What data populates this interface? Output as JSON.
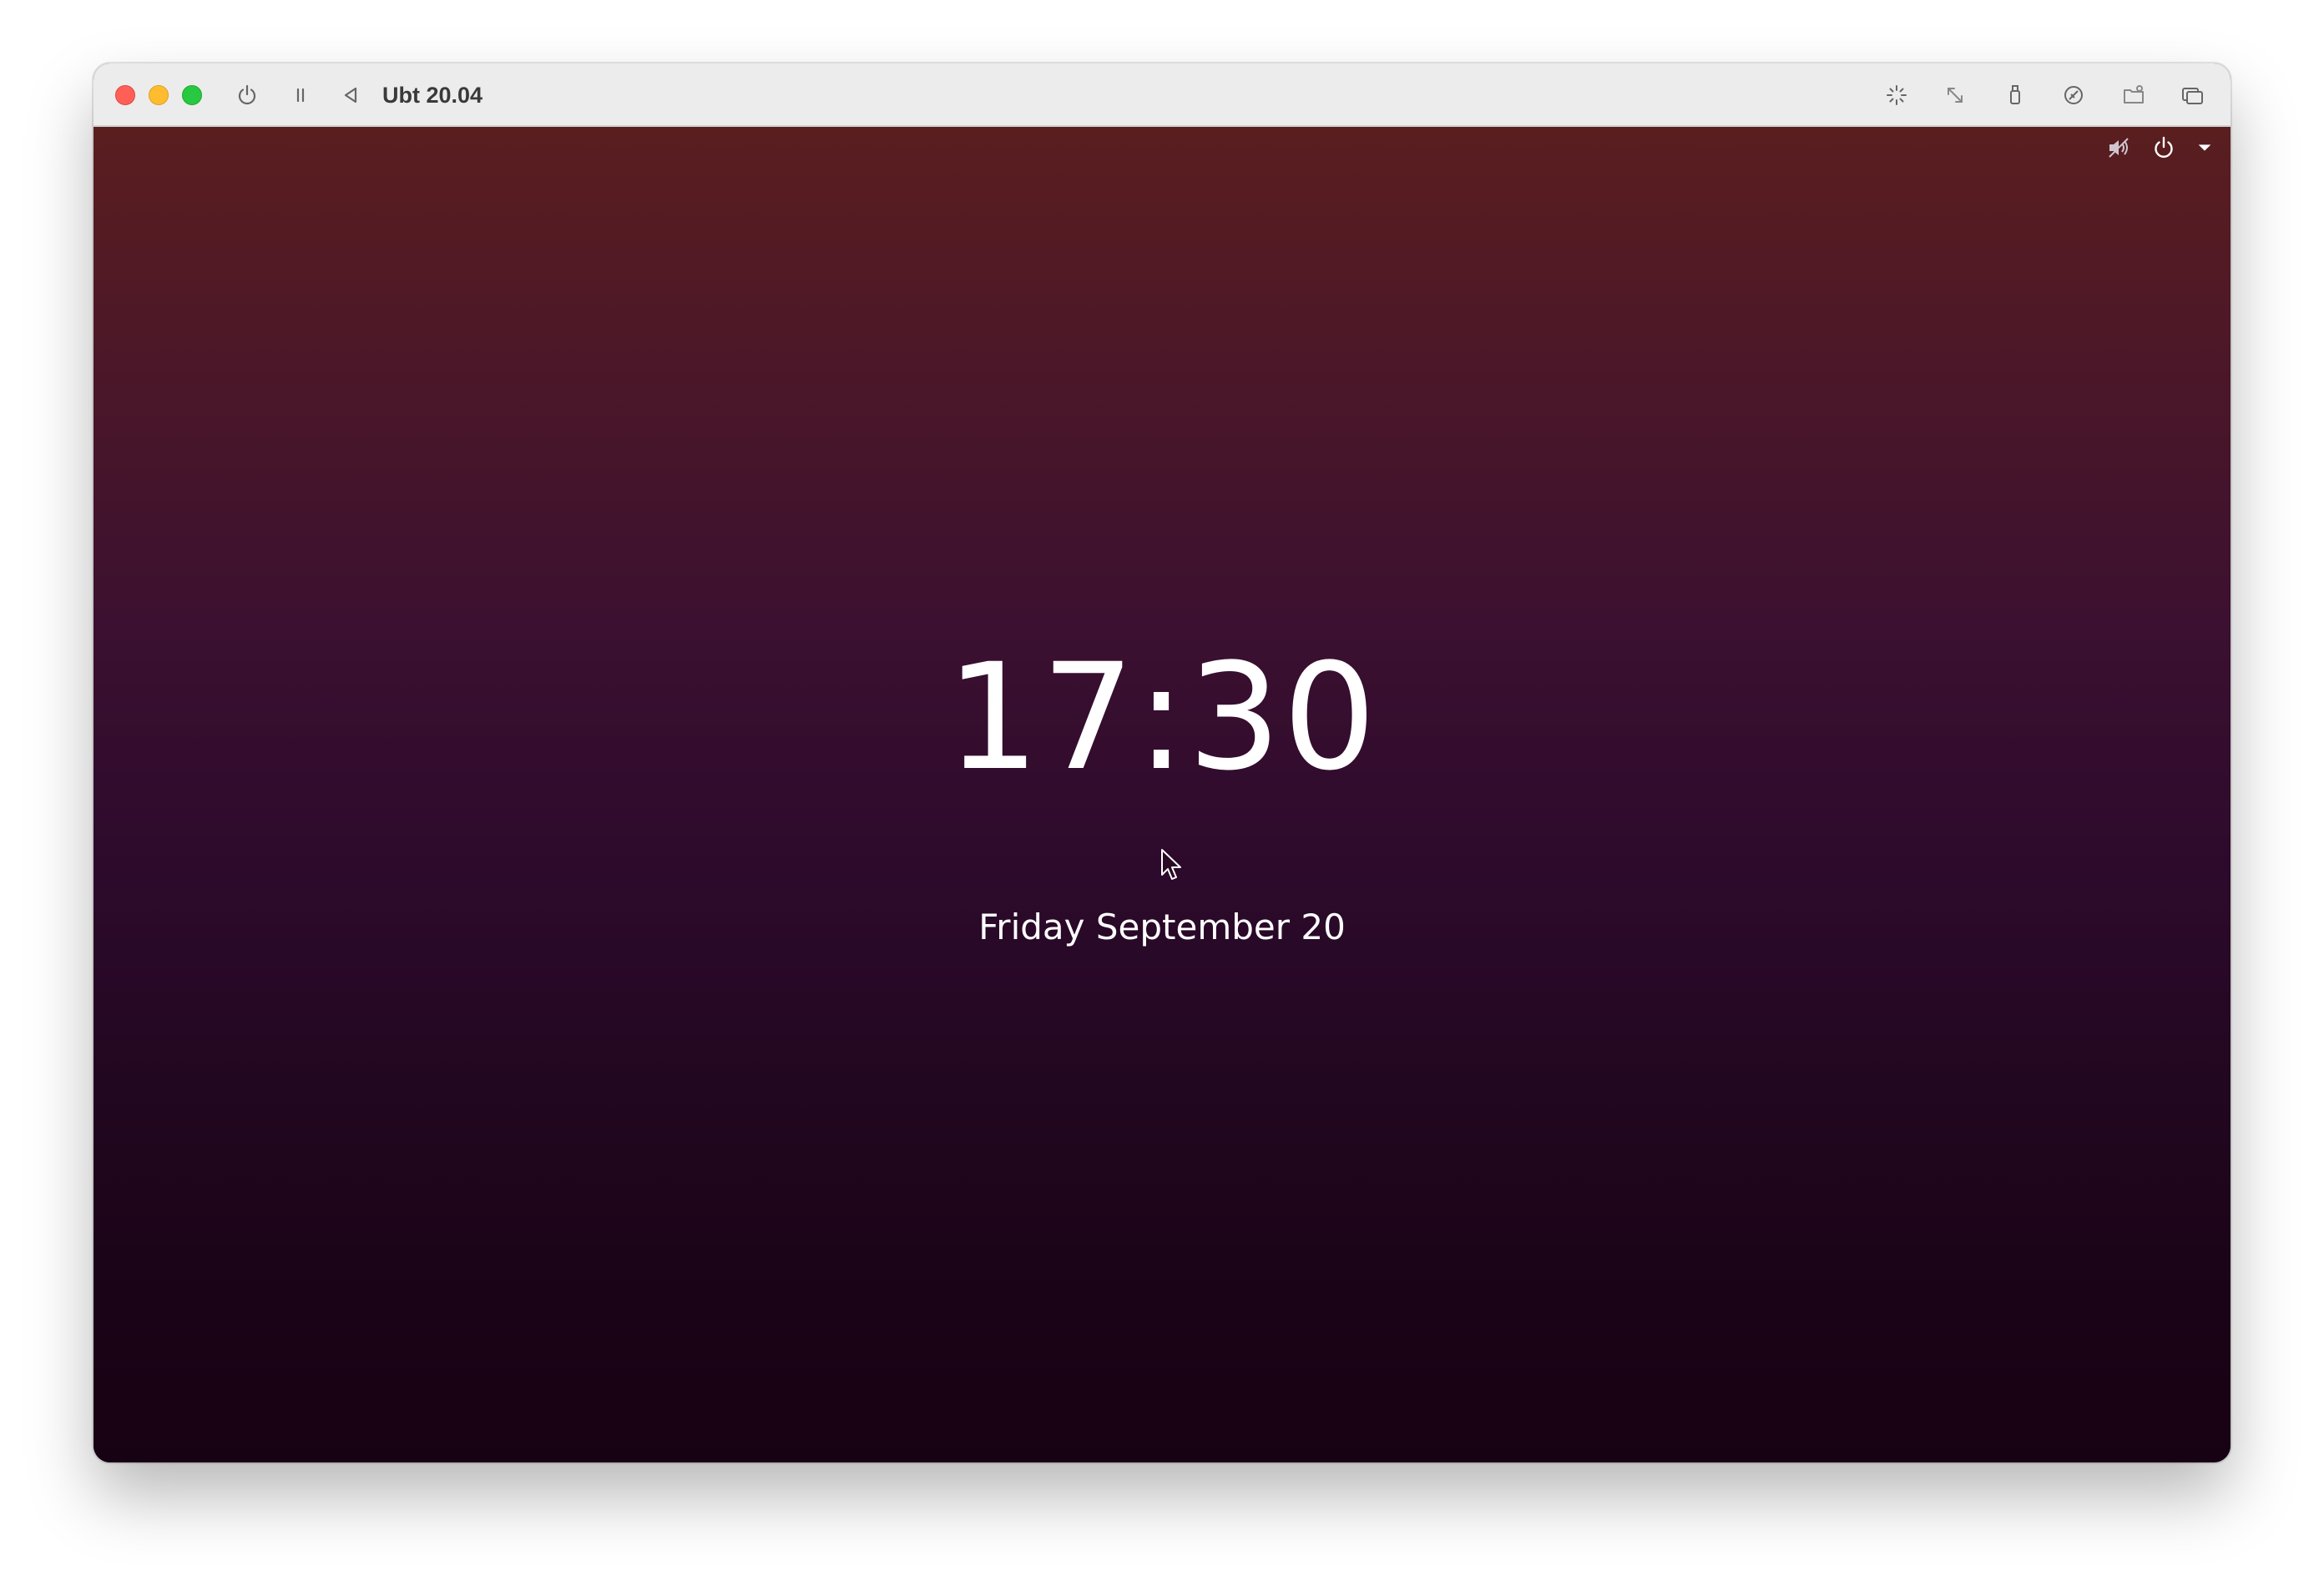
{
  "window": {
    "title": "Ubt 20.04",
    "toolbar_left_icons": [
      "power-icon",
      "pause-icon",
      "back-icon"
    ],
    "toolbar_right_icons": [
      "brightness-icon",
      "resize-icon",
      "usb-icon",
      "network-icon",
      "shared-folder-icon",
      "windows-icon"
    ]
  },
  "lockscreen": {
    "time": "17:30",
    "date": "Friday September 20",
    "top_right_icons": [
      "volume-muted-icon",
      "power-icon",
      "chevron-down-icon"
    ]
  },
  "colors": {
    "close": "#ff5f57",
    "minimize": "#febc2e",
    "maximize": "#28c840",
    "wallpaper_top": "#5a1e1f",
    "wallpaper_bottom": "#170213"
  }
}
